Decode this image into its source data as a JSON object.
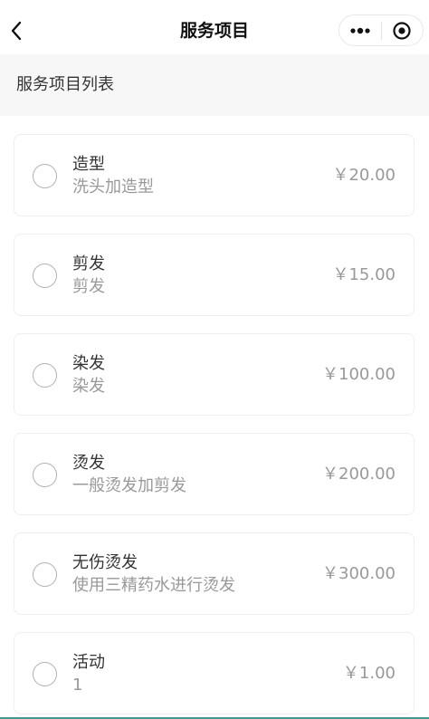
{
  "nav": {
    "title": "服务项目",
    "back_icon": "chevron-left-icon",
    "more_icon": "more-dots-icon",
    "close_icon": "target-circle-icon"
  },
  "section": {
    "title": "服务项目列表"
  },
  "currency_symbol": "￥",
  "services": [
    {
      "name": "造型",
      "desc": "洗头加造型",
      "price": "￥20.00"
    },
    {
      "name": "剪发",
      "desc": "剪发",
      "price": "￥15.00"
    },
    {
      "name": "染发",
      "desc": "染发",
      "price": "￥100.00"
    },
    {
      "name": "烫发",
      "desc": "一般烫发加剪发",
      "price": "￥200.00"
    },
    {
      "name": "无伤烫发",
      "desc": "使用三精药水进行烫发",
      "price": "￥300.00"
    },
    {
      "name": "活动",
      "desc": "1",
      "price": "￥1.00"
    }
  ],
  "colors": {
    "accent_line": "#3a9e8f",
    "text_primary": "#333333",
    "text_secondary": "#999999",
    "header_bg": "#f7f7f7"
  }
}
